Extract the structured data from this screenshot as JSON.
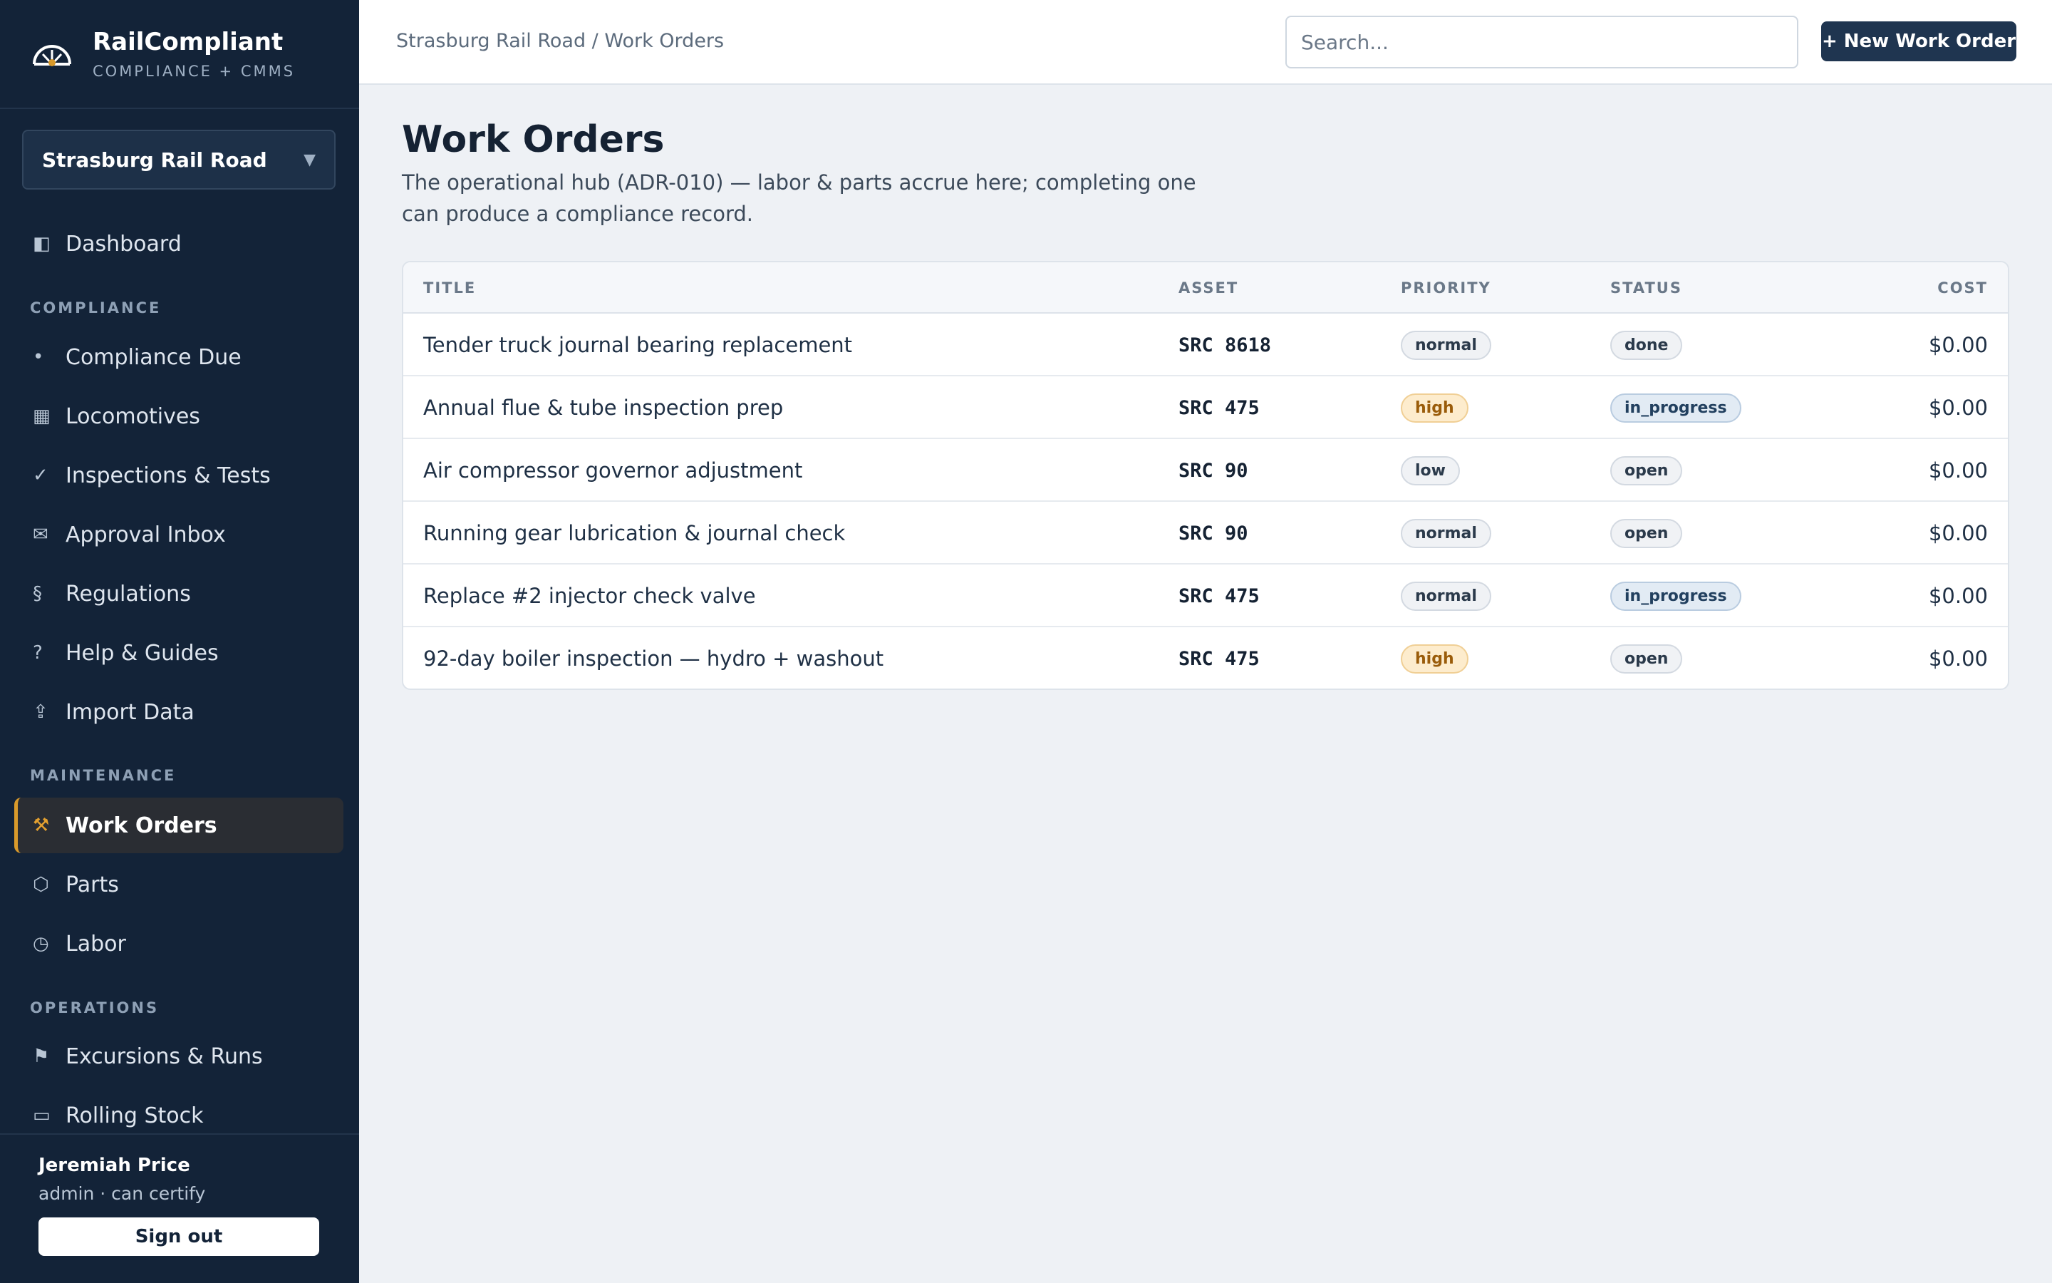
{
  "brand": {
    "name": "RailCompliant",
    "subtitle": "COMPLIANCE + CMMS"
  },
  "org_select": {
    "label": "Strasburg Rail Road"
  },
  "nav": {
    "dashboard": {
      "label": "Dashboard",
      "icon": "◧"
    },
    "compliance_section": "COMPLIANCE",
    "compliance": [
      {
        "label": "Compliance Due",
        "icon": "•"
      },
      {
        "label": "Locomotives",
        "icon": "▦"
      },
      {
        "label": "Inspections & Tests",
        "icon": "✓"
      },
      {
        "label": "Approval Inbox",
        "icon": "✉"
      },
      {
        "label": "Regulations",
        "icon": "§"
      },
      {
        "label": "Help & Guides",
        "icon": "?"
      },
      {
        "label": "Import Data",
        "icon": "⇪"
      }
    ],
    "maintenance_section": "MAINTENANCE",
    "maintenance": [
      {
        "label": "Work Orders",
        "icon": "⚒"
      },
      {
        "label": "Parts",
        "icon": "⬡"
      },
      {
        "label": "Labor",
        "icon": "◷"
      }
    ],
    "operations_section": "OPERATIONS",
    "operations": [
      {
        "label": "Excursions & Runs",
        "icon": "⚑"
      },
      {
        "label": "Rolling Stock",
        "icon": "▭"
      }
    ]
  },
  "user": {
    "name": "Jeremiah Price",
    "role": "admin · can certify",
    "signout_label": "Sign out"
  },
  "topbar": {
    "breadcrumb": "Strasburg Rail Road / Work Orders",
    "search_placeholder": "Search...",
    "new_button_label": "+ New Work Order"
  },
  "main": {
    "title": "Work Orders",
    "description": "The operational hub (ADR-010) — labor & parts accrue here; completing one can produce a compliance record."
  },
  "table": {
    "headers": {
      "title": "TITLE",
      "asset": "ASSET",
      "priority": "PRIORITY",
      "status": "STATUS",
      "cost": "COST"
    },
    "rows": [
      {
        "title": "Tender truck journal bearing replacement",
        "asset": "SRC 8618",
        "priority": "normal",
        "status": "done",
        "cost": "$0.00"
      },
      {
        "title": "Annual flue & tube inspection prep",
        "asset": "SRC 475",
        "priority": "high",
        "status": "in_progress",
        "cost": "$0.00"
      },
      {
        "title": "Air compressor governor adjustment",
        "asset": "SRC 90",
        "priority": "low",
        "status": "open",
        "cost": "$0.00"
      },
      {
        "title": "Running gear lubrication & journal check",
        "asset": "SRC 90",
        "priority": "normal",
        "status": "open",
        "cost": "$0.00"
      },
      {
        "title": "Replace #2 injector check valve",
        "asset": "SRC 475",
        "priority": "normal",
        "status": "in_progress",
        "cost": "$0.00"
      },
      {
        "title": "92-day boiler inspection — hydro + washout",
        "asset": "SRC 475",
        "priority": "high",
        "status": "open",
        "cost": "$0.00"
      }
    ]
  },
  "colors": {
    "sidebar_bg": "#132338",
    "accent": "#d99a2b",
    "primary_button": "#1f3550"
  }
}
